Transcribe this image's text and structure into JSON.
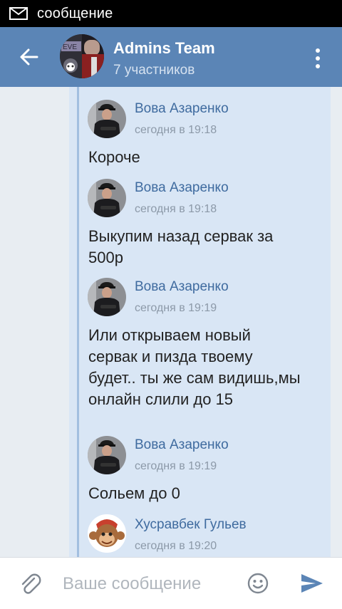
{
  "status_bar": {
    "notification_text": "сообщение",
    "icon": "mail-icon"
  },
  "header": {
    "title": "Admins Team",
    "subtitle": "7 участников",
    "back_icon": "arrow-left-icon",
    "menu_icon": "more-vertical-icon"
  },
  "messages": [
    {
      "author": "Вова Азаренко",
      "time": "сегодня в 19:18",
      "text": "Короче"
    },
    {
      "author": "Вова Азаренко",
      "time": "сегодня в 19:18",
      "text": "Выкупим назад сервак за 500р"
    },
    {
      "author": "Вова Азаренко",
      "time": "сегодня в 19:19",
      "text": "Или открываем новый сервак и пизда твоему будет.. ты же сам видишь,мы онлайн слили до 15"
    },
    {
      "author": "Вова Азаренко",
      "time": "сегодня в 19:19",
      "text": "Сольем до 0"
    },
    {
      "author": "Хусравбек Гульев",
      "time": "сегодня в 19:20",
      "text": ""
    }
  ],
  "input": {
    "placeholder": "Ваше сообщение",
    "value": "",
    "attach_icon": "paperclip-icon",
    "emoji_icon": "emoji-icon",
    "send_icon": "send-icon"
  },
  "colors": {
    "header": "#5b85b6",
    "bubble": "#d9e6f5",
    "author_name": "#3f6b9f",
    "send_icon": "#5b85b6"
  }
}
